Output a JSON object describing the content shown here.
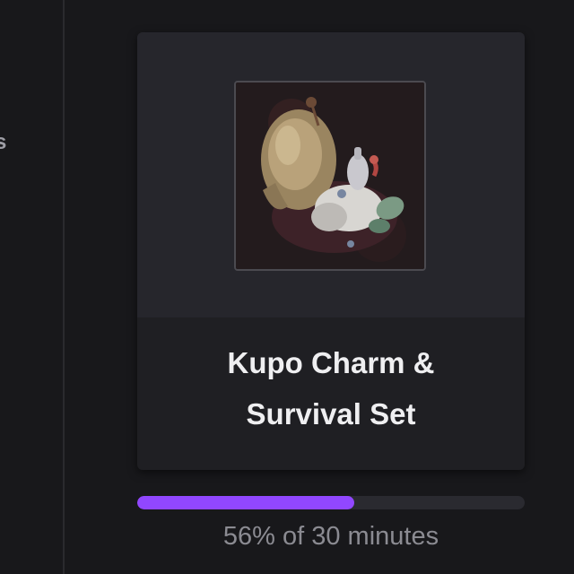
{
  "sidebar": {
    "fragment_text": "s"
  },
  "reward": {
    "title_line1": "Kupo Charm &",
    "title_line2": "Survival Set",
    "image_icon": "kupo-charm-item-icon"
  },
  "progress": {
    "percent": 56,
    "label": "56% of 30 minutes"
  },
  "colors": {
    "background": "#18181b",
    "card": "#1f1f23",
    "accent": "#9147ff",
    "title_text": "#efeff1",
    "muted_text": "#8b8b92"
  }
}
